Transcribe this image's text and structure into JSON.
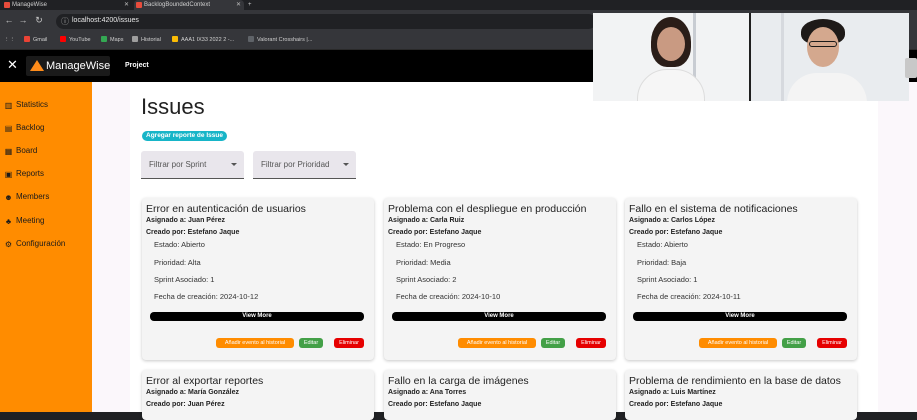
{
  "browser": {
    "tabs": [
      {
        "label": "ManageWise",
        "active": false
      },
      {
        "label": "BacklogBoundedContext",
        "active": true
      }
    ],
    "new_tab": "+",
    "url": "localhost:4200/issues",
    "bookmarks": [
      {
        "label": "Gmail",
        "color": "#ea4335"
      },
      {
        "label": "YouTube",
        "color": "#ff0000"
      },
      {
        "label": "Maps",
        "color": "#34a853"
      },
      {
        "label": "Historial",
        "color": "#9e9e9e"
      },
      {
        "label": "AAA1 IX33 2022 2 -...",
        "color": "#fbbc05"
      },
      {
        "label": "Valorant Crosshairs |...",
        "color": "#5f6368"
      }
    ]
  },
  "app": {
    "brand": "ManageWise",
    "nav_project": "Project",
    "sidebar": [
      {
        "label": "Statistics",
        "icon": "bar-chart-icon"
      },
      {
        "label": "Backlog",
        "icon": "backlog-icon"
      },
      {
        "label": "Board",
        "icon": "board-icon"
      },
      {
        "label": "Reports",
        "icon": "reports-icon"
      },
      {
        "label": "Members",
        "icon": "members-icon"
      },
      {
        "label": "Meeting",
        "icon": "meeting-icon"
      },
      {
        "label": "Configuración",
        "icon": "gear-icon"
      }
    ]
  },
  "issues_page": {
    "title": "Issues",
    "add_button": "Agregar reporte de Issue",
    "filter_sprint": "Filtrar por Sprint",
    "filter_priority": "Filtrar por Prioridad",
    "view_more": "View More",
    "btn_history": "Añadir evento al historial",
    "btn_edit": "Editar",
    "btn_delete": "Eliminar",
    "cards": [
      {
        "title": "Error en autenticación de usuarios",
        "assigned": "Asignado a: Juan Pérez",
        "created": "Creado por: Estefano Jaque",
        "estado": "Estado: Abierto",
        "prioridad": "Prioridad: Alta",
        "sprint": "Sprint Asociado: 1",
        "fecha": "Fecha de creación: 2024-10-12"
      },
      {
        "title": "Problema con el despliegue en producción",
        "assigned": "Asignado a: Carla Ruiz",
        "created": "Creado por: Estefano Jaque",
        "estado": "Estado: En Progreso",
        "prioridad": "Prioridad: Media",
        "sprint": "Sprint Asociado: 2",
        "fecha": "Fecha de creación: 2024-10-10"
      },
      {
        "title": "Fallo en el sistema de notificaciones",
        "assigned": "Asignado a: Carlos López",
        "created": "Creado por: Estefano Jaque",
        "estado": "Estado: Abierto",
        "prioridad": "Prioridad: Baja",
        "sprint": "Sprint Asociado: 1",
        "fecha": "Fecha de creación: 2024-10-11"
      },
      {
        "title": "Error al exportar reportes",
        "assigned": "Asignado a: María González",
        "created": "Creado por: Juan Pérez"
      },
      {
        "title": "Fallo en la carga de imágenes",
        "assigned": "Asignado a: Ana Torres",
        "created": "Creado por: Estefano Jaque"
      },
      {
        "title": "Problema de rendimiento en la base de datos",
        "assigned": "Asignado a: Luis Martínez",
        "created": "Creado por: Estefano Jaque"
      }
    ]
  },
  "colors": {
    "sidebar": "#ff8c00",
    "topbar": "#000000",
    "add_button": "#17b5c8",
    "history": "#ff8c00",
    "edit": "#43a047",
    "delete": "#e60000"
  }
}
